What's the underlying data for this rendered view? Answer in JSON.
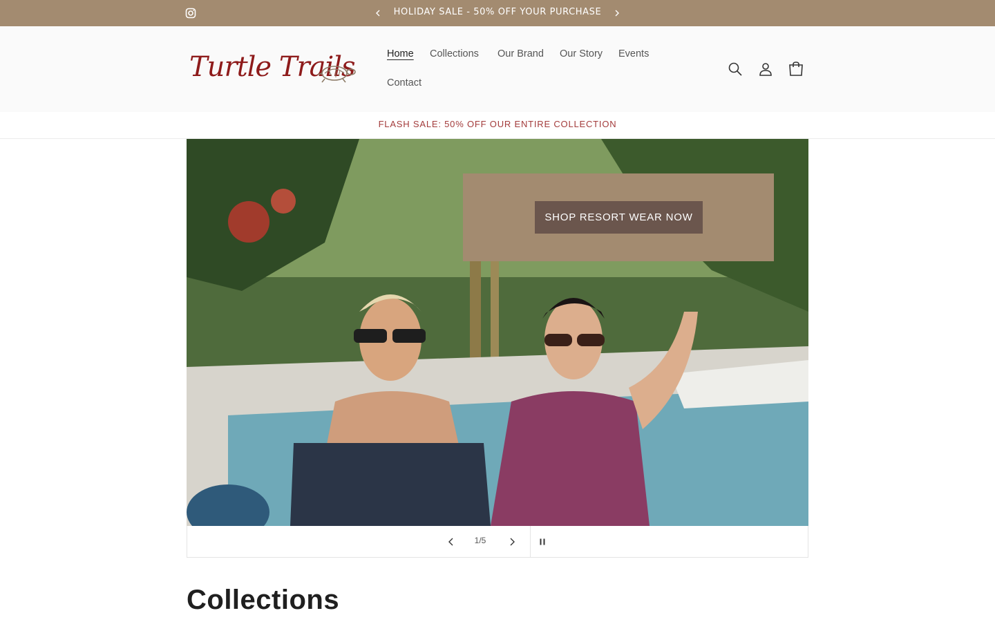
{
  "announcement": {
    "message": "HOLIDAY SALE - 50% OFF YOUR PURCHASE",
    "social_icon": "instagram-icon",
    "prev_icon": "chevron-left-icon",
    "next_icon": "chevron-right-icon"
  },
  "brand": {
    "logo_text": "Turtle Trails",
    "logo_icon": "turtle-icon",
    "accent_color": "#8e1b1b"
  },
  "nav": {
    "items": [
      {
        "label": "Home",
        "active": true
      },
      {
        "label": "Collections"
      },
      {
        "label": "Our Brand"
      },
      {
        "label": "Our Story"
      },
      {
        "label": "Events"
      },
      {
        "label": "Contact"
      }
    ]
  },
  "header_icons": [
    "search-icon",
    "account-icon",
    "cart-icon"
  ],
  "flash": {
    "message": "FLASH SALE: 50% OFF OUR ENTIRE COLLECTION",
    "color": "#a33b3b"
  },
  "hero": {
    "button_label": "SHOP RESORT WEAR NOW",
    "box_color": "#a38b70",
    "button_color": "#6b564d"
  },
  "slider": {
    "counter": "1/5",
    "prev_icon": "chevron-left-icon",
    "next_icon": "chevron-right-icon",
    "pause_icon": "pause-icon"
  },
  "collections": {
    "title": "Collections"
  },
  "colors": {
    "announcement_bg": "#a38b70",
    "header_bg": "#fafafa"
  }
}
